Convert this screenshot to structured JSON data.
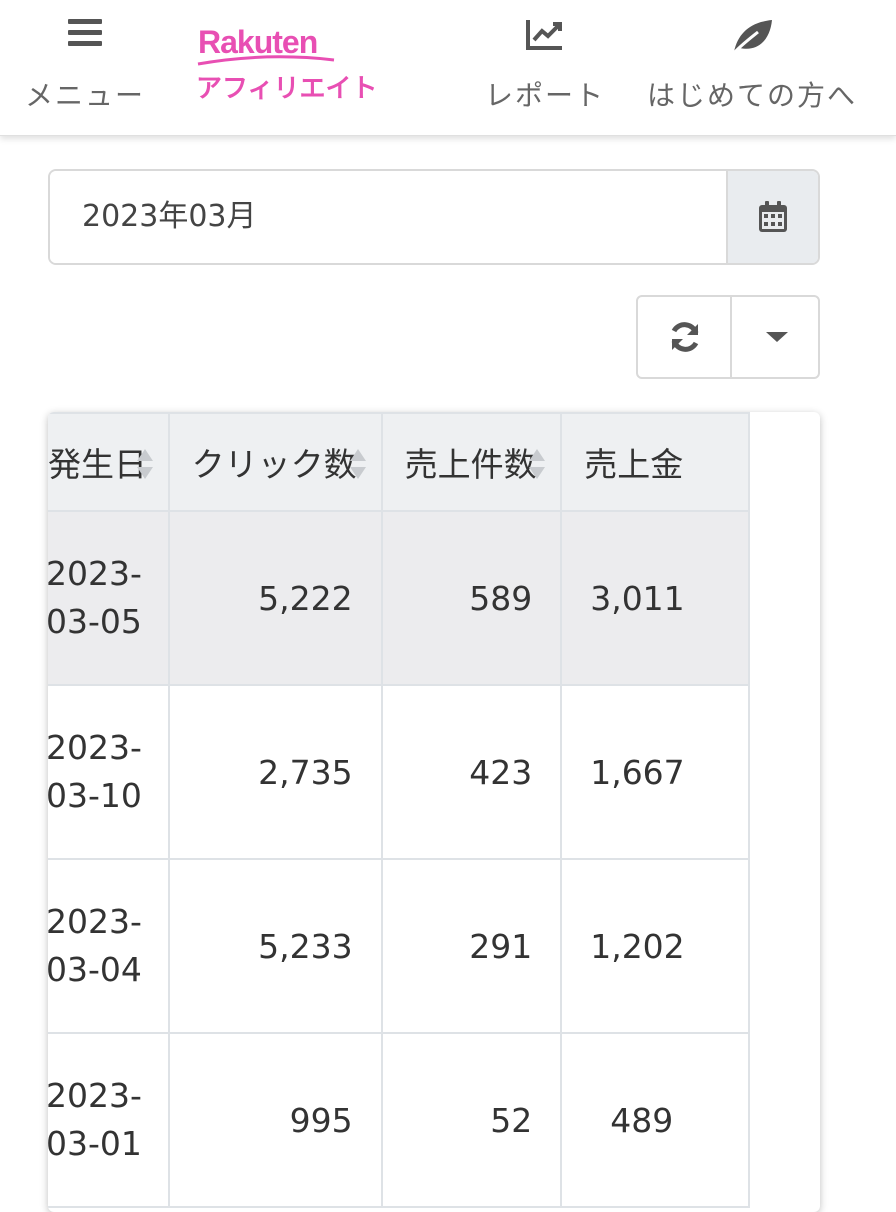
{
  "header": {
    "menu_label": "メニュー",
    "logo_brand": "Rakuten",
    "logo_sub": "アフィリエイト",
    "report_label": "レポート",
    "beginners_label": "はじめての方へ",
    "brand_color": "#e84fb3"
  },
  "date_picker": {
    "value": "2023年03月",
    "icon": "calendar-icon"
  },
  "toolbar": {
    "refresh_icon": "refresh-icon",
    "dropdown_icon": "caret-down-icon"
  },
  "table": {
    "columns": [
      "発生日",
      "クリック数",
      "売上件数",
      "売上金"
    ],
    "rows": [
      {
        "date_year": "2023-",
        "date_md": "03-05",
        "clicks": "5,222",
        "sales_count": "589",
        "sales_amount": "3,011"
      },
      {
        "date_year": "2023-",
        "date_md": "03-10",
        "clicks": "2,735",
        "sales_count": "423",
        "sales_amount": "1,667"
      },
      {
        "date_year": "2023-",
        "date_md": "03-04",
        "clicks": "5,233",
        "sales_count": "291",
        "sales_amount": "1,202"
      },
      {
        "date_year": "2023-",
        "date_md": "03-01",
        "clicks": "995",
        "sales_count": "52",
        "sales_amount": "489"
      }
    ]
  }
}
